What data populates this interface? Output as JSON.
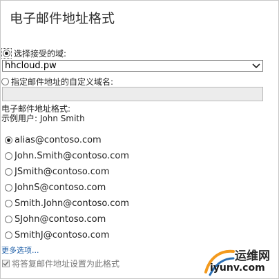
{
  "page_title": "电子邮件地址格式",
  "domain_options": {
    "accepted_label": "选择接受的域:",
    "accepted_selected": true,
    "accepted_domain_value": "hhcloud.pw",
    "custom_label": "指定邮件地址的自定义域名:",
    "custom_selected": false,
    "custom_domain_value": ""
  },
  "format_section": {
    "heading": "电子邮件地址格式:",
    "example_user": "示例用户: John Smith"
  },
  "formats": [
    {
      "label": "alias@contoso.com",
      "selected": true
    },
    {
      "label": "John.Smith@contoso.com",
      "selected": false
    },
    {
      "label": "JSmith@contoso.com",
      "selected": false
    },
    {
      "label": "JohnS@contoso.com",
      "selected": false
    },
    {
      "label": "Smith.John@contoso.com",
      "selected": false
    },
    {
      "label": "SJohn@contoso.com",
      "selected": false
    },
    {
      "label": "SmithJ@contoso.com",
      "selected": false
    }
  ],
  "more_options_label": "更多选项...",
  "reply_checkbox": {
    "label": "将答复邮件地址设置为此格式",
    "checked": true
  },
  "watermark": {
    "line1": "运维网",
    "line2": "iyunv.com"
  },
  "colors": {
    "link": "#1f5fa8",
    "watermark_orange": "#f39a1e",
    "watermark_blue": "#2b6fb4"
  }
}
